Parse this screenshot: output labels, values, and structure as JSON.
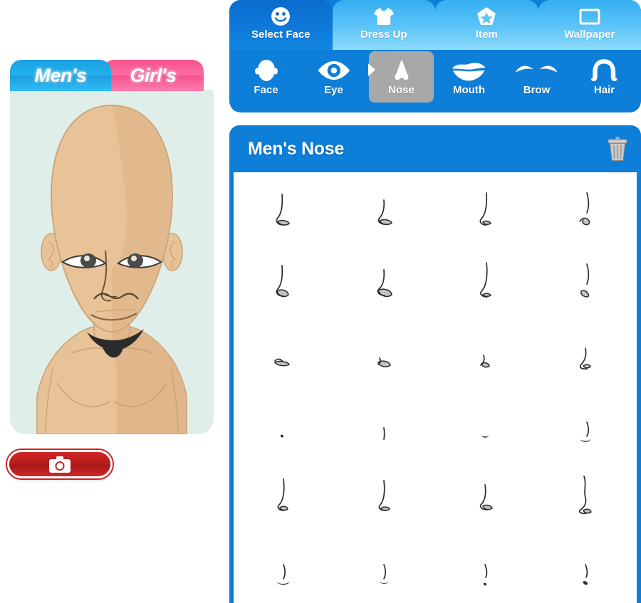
{
  "app": {
    "accent_blue": "#0d7fd8",
    "tab_light_blue": "#5ec4f7",
    "pink": "#f7548e",
    "stage_bg": "#dfeee8",
    "selected_gray": "#a8a8a8",
    "camera_red": "#c42020"
  },
  "left_panel": {
    "gender_tabs": [
      {
        "label": "Men's",
        "active": true,
        "icon": "none"
      },
      {
        "label": "Girl's",
        "active": false,
        "icon": "none"
      }
    ],
    "avatar": {
      "name": "avatar-preview",
      "description": "Bald male cartoon avatar, bare torso, narrow eyes, goatee",
      "skin": "#e8c398",
      "skin_shade": "#d8ae81",
      "outline": "#6a4a2c",
      "hair_color": "#2b2b2b",
      "background": "#dfeee8"
    },
    "camera_button": {
      "icon": "camera-icon",
      "label": ""
    }
  },
  "nav": {
    "main_tabs": [
      {
        "label": "Select Face",
        "icon": "smiley-face-icon",
        "active": true
      },
      {
        "label": "Dress Up",
        "icon": "tshirt-icon",
        "active": false
      },
      {
        "label": "Item",
        "icon": "star-icon",
        "active": false
      },
      {
        "label": "Wallpaper",
        "icon": "wallpaper-frame-icon",
        "active": false
      }
    ],
    "sub_tabs": [
      {
        "label": "Face",
        "icon": "face-shape-icon",
        "selected": false
      },
      {
        "label": "Eye",
        "icon": "eye-icon",
        "selected": false
      },
      {
        "label": "Nose",
        "icon": "nose-icon",
        "selected": true
      },
      {
        "label": "Mouth",
        "icon": "mouth-lips-icon",
        "selected": false
      },
      {
        "label": "Brow",
        "icon": "eyebrow-icon",
        "selected": false
      },
      {
        "label": "Hair",
        "icon": "hair-icon",
        "selected": false
      }
    ]
  },
  "content": {
    "title": "Men's Nose",
    "delete_icon": "trash-icon",
    "grid": {
      "columns": 4,
      "rows": 6,
      "total_items": 24,
      "items": [
        {
          "id": 1,
          "variant": "hook-left-wide-nostril"
        },
        {
          "id": 2,
          "variant": "short-hook-flat-nostril"
        },
        {
          "id": 3,
          "variant": "slim-hook-small-nostril"
        },
        {
          "id": 4,
          "variant": "straight-bridge-curl-nostril"
        },
        {
          "id": 5,
          "variant": "hook-round-nostril"
        },
        {
          "id": 6,
          "variant": "short-hook-round-nostril"
        },
        {
          "id": 7,
          "variant": "long-slim-hook"
        },
        {
          "id": 8,
          "variant": "straight-bridge-hook-nostril"
        },
        {
          "id": 9,
          "variant": "flat-wide-low"
        },
        {
          "id": 10,
          "variant": "flat-hook-low"
        },
        {
          "id": 11,
          "variant": "small-hook-low"
        },
        {
          "id": 12,
          "variant": "curved-hook-tall"
        },
        {
          "id": 13,
          "variant": "tiny-dot"
        },
        {
          "id": 14,
          "variant": "single-vertical-line"
        },
        {
          "id": 15,
          "variant": "tiny-downward-curve"
        },
        {
          "id": 16,
          "variant": "bridge-plus-curve"
        },
        {
          "id": 17,
          "variant": "tall-slim-hook-nostril"
        },
        {
          "id": 18,
          "variant": "tall-hook-flat-nostril"
        },
        {
          "id": 19,
          "variant": "short-thick-hook"
        },
        {
          "id": 20,
          "variant": "long-wavy-hook"
        },
        {
          "id": 21,
          "variant": "bridge-plus-wide-curve"
        },
        {
          "id": 22,
          "variant": "bridge-plus-small-curve"
        },
        {
          "id": 23,
          "variant": "bridge-plus-dot"
        },
        {
          "id": 24,
          "variant": "bridge-plus-tiny-hook"
        }
      ]
    }
  }
}
